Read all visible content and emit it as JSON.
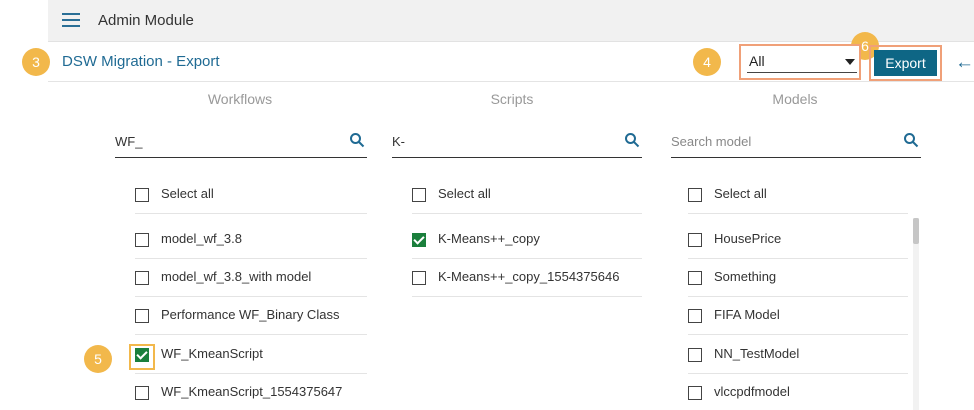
{
  "header": {
    "app_title": "Admin Module"
  },
  "subheader": {
    "page_title": "DSW Migration - Export"
  },
  "badges": {
    "b3": "3",
    "b4": "4",
    "b5": "5",
    "b6": "6"
  },
  "filter": {
    "value": "All"
  },
  "export": {
    "label": "Export"
  },
  "columns": {
    "workflows": {
      "header": "Workflows",
      "search_value": "WF_",
      "search_placeholder": "",
      "items": [
        {
          "label": "Select all",
          "checked": false
        },
        {
          "label": "model_wf_3.8",
          "checked": false
        },
        {
          "label": "model_wf_3.8_with model",
          "checked": false
        },
        {
          "label": "Performance WF_Binary Class",
          "checked": false
        },
        {
          "label": "WF_KmeanScript",
          "checked": true
        },
        {
          "label": "WF_KmeanScript_1554375647",
          "checked": false
        }
      ]
    },
    "scripts": {
      "header": "Scripts",
      "search_value": "K-",
      "search_placeholder": "",
      "items": [
        {
          "label": "Select all",
          "checked": false
        },
        {
          "label": "K-Means++_copy",
          "checked": true
        },
        {
          "label": "K-Means++_copy_1554375646",
          "checked": false
        }
      ]
    },
    "models": {
      "header": "Models",
      "search_value": "",
      "search_placeholder": "Search model",
      "items": [
        {
          "label": "Select all",
          "checked": false
        },
        {
          "label": "HousePrice",
          "checked": false
        },
        {
          "label": "Something",
          "checked": false
        },
        {
          "label": "FIFA Model",
          "checked": false
        },
        {
          "label": "NN_TestModel",
          "checked": false
        },
        {
          "label": "vlccpdfmodel",
          "checked": false
        }
      ]
    }
  },
  "colors": {
    "accent": "#1f6a93",
    "export_bg": "#0e6685",
    "badge": "#f2b84b",
    "highlight_border": "#f0a078",
    "check": "#1a7f3c"
  }
}
